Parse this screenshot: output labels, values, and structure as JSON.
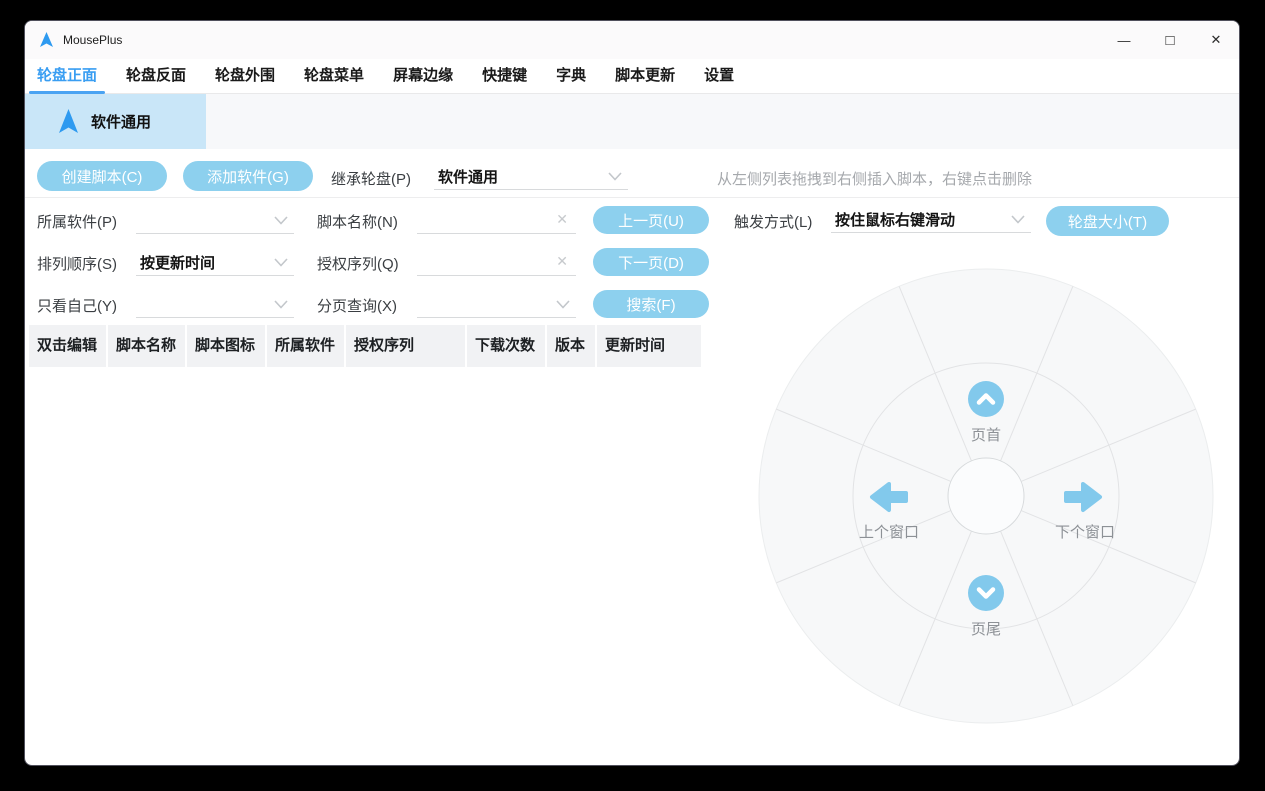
{
  "app": {
    "title": "MousePlus"
  },
  "window_controls": {
    "minimize": "—",
    "maximize": "□",
    "close": "✕"
  },
  "tabs": [
    {
      "label": "轮盘正面",
      "active": true
    },
    {
      "label": "轮盘反面",
      "active": false
    },
    {
      "label": "轮盘外围",
      "active": false
    },
    {
      "label": "轮盘菜单",
      "active": false
    },
    {
      "label": "屏幕边缘",
      "active": false
    },
    {
      "label": "快捷键",
      "active": false
    },
    {
      "label": "字典",
      "active": false
    },
    {
      "label": "脚本更新",
      "active": false
    },
    {
      "label": "设置",
      "active": false
    }
  ],
  "profile": {
    "selected_label": "软件通用"
  },
  "toolbar": {
    "create_script": "创建脚本(C)",
    "add_software": "添加软件(G)",
    "inherit_label": "继承轮盘(P)",
    "inherit_value": "软件通用",
    "hint": "从左侧列表拖拽到右侧插入脚本，右键点击删除"
  },
  "filters": {
    "rows": [
      {
        "label_a": "所属软件(P)",
        "value_a": "",
        "label_b": "脚本名称(N)",
        "value_b": "",
        "action": "上一页(U)"
      },
      {
        "label_a": "排列顺序(S)",
        "value_a": "按更新时间",
        "label_b": "授权序列(Q)",
        "value_b": "",
        "action": "下一页(D)"
      },
      {
        "label_a": "只看自己(Y)",
        "value_a": "",
        "label_b": "分页查询(X)",
        "value_b": "",
        "action": "搜索(F)"
      }
    ],
    "clear_glyph": "✕",
    "trigger": {
      "label": "触发方式(L)",
      "value": "按住鼠标右键滑动",
      "action": "轮盘大小(T)"
    }
  },
  "table": {
    "headers": [
      "双击编辑",
      "脚本名称",
      "脚本图标",
      "所属软件",
      "授权序列",
      "下载次数",
      "版本",
      "更新时间"
    ]
  },
  "wheel": {
    "top": {
      "label": "页首",
      "icon": "chevron-up-circle-icon"
    },
    "bottom": {
      "label": "页尾",
      "icon": "chevron-down-circle-icon"
    },
    "left": {
      "label": "上个窗口",
      "icon": "arrow-left-icon"
    },
    "right": {
      "label": "下个窗口",
      "icon": "arrow-right-icon"
    }
  },
  "colors": {
    "accent_blue": "#2e9af0",
    "active_tab_blue": "#3a9ef2",
    "button_blue": "#8dd0ee",
    "selected_item_bg": "#c9e6f8",
    "wheel_icon_blue": "#82c9ec",
    "hint_gray": "#a5a8ac"
  }
}
